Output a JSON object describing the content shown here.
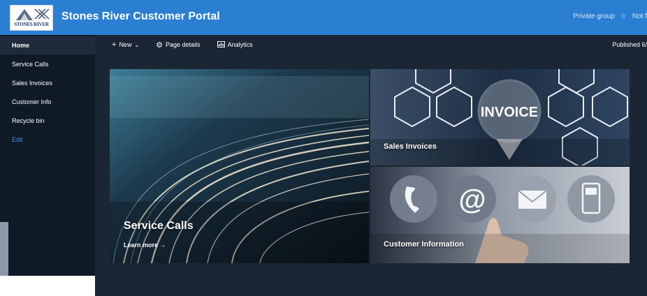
{
  "header": {
    "site_title": "Stones River Customer Portal",
    "logo_text": "STONES RIVER",
    "private_group": "Private group",
    "star_icon": "star-icon",
    "following": "Not f"
  },
  "sidebar": {
    "items": [
      {
        "label": "Home",
        "active": true
      },
      {
        "label": "Service Calls"
      },
      {
        "label": "Sales Invoices"
      },
      {
        "label": "Customer Info"
      },
      {
        "label": "Recycle bin"
      },
      {
        "label": "Edit",
        "link": true
      }
    ]
  },
  "commandbar": {
    "new_label": "New",
    "page_details_label": "Page details",
    "analytics_label": "Analytics",
    "published": "Published 6/"
  },
  "tiles": {
    "service_calls": {
      "title": "Service Calls",
      "learn_more": "Learn more"
    },
    "sales_invoices": {
      "title": "Sales Invoices",
      "badge": "INVOICE"
    },
    "customer_info": {
      "title": "Customer Information"
    }
  },
  "colors": {
    "topbar": "#2b7fd3",
    "sidebar": "#0f1a27",
    "canvas": "#1b2634",
    "accent_link": "#3a8fe0"
  }
}
